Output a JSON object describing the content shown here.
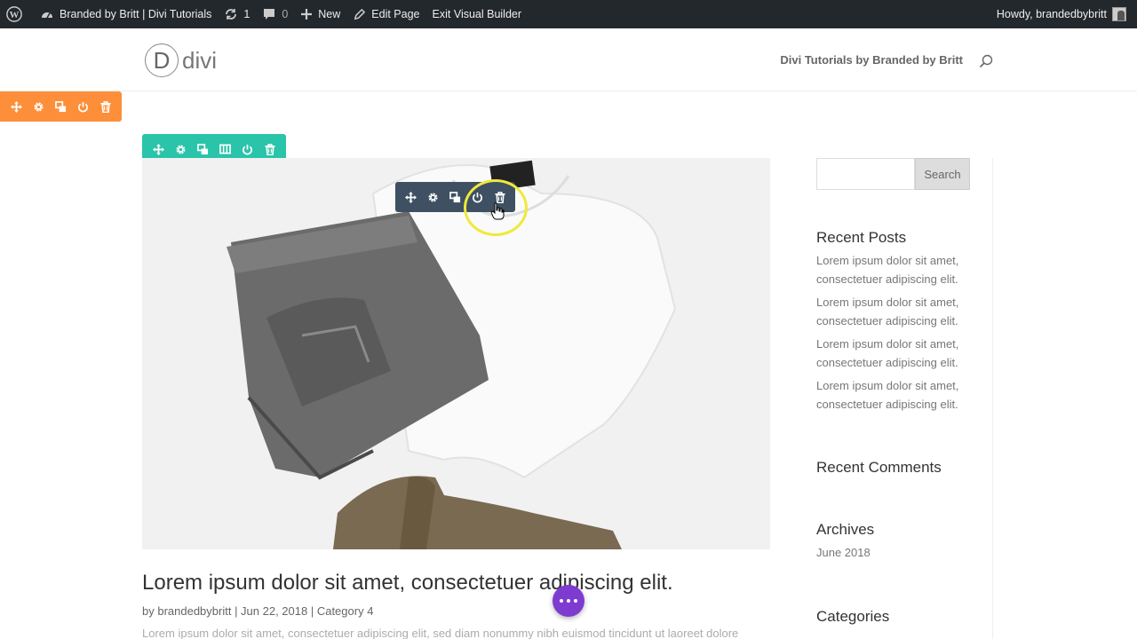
{
  "admin_bar": {
    "site_name": "Branded by Britt | Divi Tutorials",
    "updates_count": "1",
    "comments_count": "0",
    "new_label": "New",
    "edit_label": "Edit Page",
    "exit_label": "Exit Visual Builder",
    "greeting": "Howdy, brandedbybritt"
  },
  "header": {
    "logo_letter": "D",
    "logo_text": "divi",
    "nav_link": "Divi Tutorials by Branded by Britt"
  },
  "post": {
    "title": "Lorem ipsum dolor sit amet, consectetuer adipiscing elit.",
    "meta": "by brandedbybritt | Jun 22, 2018 | Category 4",
    "excerpt": "Lorem ipsum dolor sit amet, consectetuer adipiscing elit, sed diam nonummy nibh euismod tincidunt ut laoreet dolore"
  },
  "sidebar": {
    "search_button": "Search",
    "recent_posts_title": "Recent Posts",
    "recent_posts": [
      "Lorem ipsum dolor sit amet, consectetuer adipiscing elit.",
      "Lorem ipsum dolor sit amet, consectetuer adipiscing elit.",
      "Lorem ipsum dolor sit amet, consectetuer adipiscing elit.",
      "Lorem ipsum dolor sit amet, consectetuer adipiscing elit."
    ],
    "recent_comments_title": "Recent Comments",
    "archives_title": "Archives",
    "archives": [
      "June 2018"
    ],
    "categories_title": "Categories"
  },
  "colors": {
    "section_toolbar": "#fd8f3a",
    "row_toolbar": "#29c4a9",
    "module_toolbar": "#3e5062",
    "fab": "#7e3bd0"
  }
}
